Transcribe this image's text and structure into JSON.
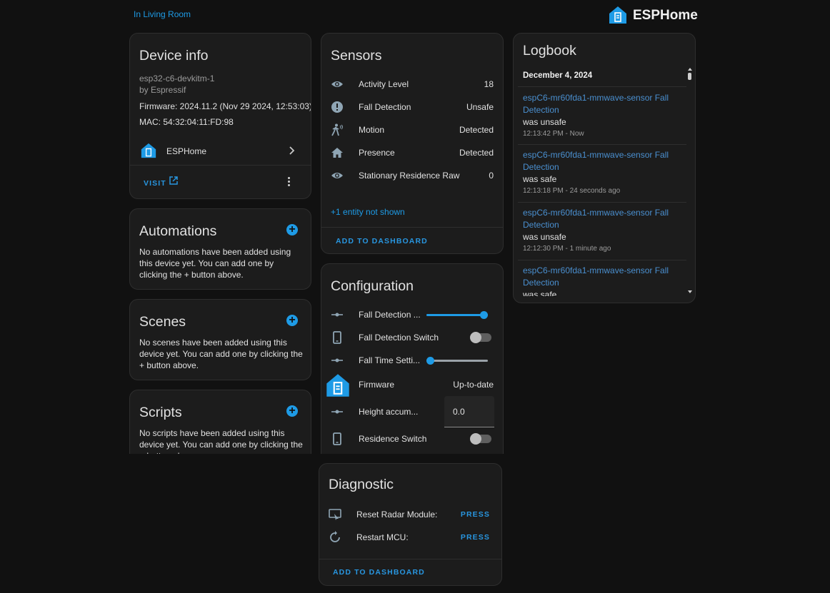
{
  "header": {
    "area_link": "In Living Room",
    "brand": "ESPHome",
    "brand_color": "#1e9be6"
  },
  "device_info": {
    "title": "Device info",
    "model": "esp32-c6-devkitm-1",
    "manufacturer": "by Espressif",
    "firmware": "Firmware: 2024.11.2 (Nov 29 2024, 12:53:03)",
    "mac": "MAC: 54:32:04:11:FD:98",
    "integration": "ESPHome",
    "visit_label": "VISIT"
  },
  "automations": {
    "title": "Automations",
    "text": "No automations have been added using this device yet. You can add one by clicking the + button above."
  },
  "scenes": {
    "title": "Scenes",
    "text": "No scenes have been added using this device yet. You can add one by clicking the + button above."
  },
  "scripts": {
    "title": "Scripts",
    "text": "No scripts have been added using this device yet. You can add one by clicking the + button above."
  },
  "sensors": {
    "title": "Sensors",
    "rows": [
      {
        "icon": "eye-icon",
        "label": "Activity Level",
        "value": "18"
      },
      {
        "icon": "alert-circle-icon",
        "label": "Fall Detection",
        "value": "Unsafe"
      },
      {
        "icon": "motion-icon",
        "label": "Motion",
        "value": "Detected"
      },
      {
        "icon": "home-icon",
        "label": "Presence",
        "value": "Detected"
      },
      {
        "icon": "eye-icon",
        "label": "Stationary Residence Raw",
        "value": "0"
      }
    ],
    "more_link": "+1 entity not shown",
    "add_label": "ADD TO DASHBOARD"
  },
  "configuration": {
    "title": "Configuration",
    "fall_detection_label": "Fall Detection ...",
    "fall_detection_level": 1.0,
    "fall_switch_label": "Fall Detection Switch",
    "fall_switch_on": false,
    "fall_time_label": "Fall Time Setti...",
    "fall_time_level": 0.0,
    "firmware_label": "Firmware",
    "firmware_value": "Up-to-date",
    "height_label": "Height accum...",
    "height_value": "0.0",
    "residence_label": "Residence Switch",
    "residence_on": false
  },
  "diagnostic": {
    "title": "Diagnostic",
    "reset_label": "Reset Radar Module:",
    "reset_action": "PRESS",
    "restart_label": "Restart MCU:",
    "restart_action": "PRESS",
    "add_label": "ADD TO DASHBOARD"
  },
  "logbook": {
    "title": "Logbook",
    "date": "December 4, 2024",
    "entries": [
      {
        "entity": "espC6-mr60fda1-mmwave-sensor Fall Detection",
        "state": "was unsafe",
        "time": "12:13:42 PM - Now"
      },
      {
        "entity": "espC6-mr60fda1-mmwave-sensor Fall Detection",
        "state": "was safe",
        "time": "12:13:18 PM - 24 seconds ago"
      },
      {
        "entity": "espC6-mr60fda1-mmwave-sensor Fall Detection",
        "state": "was unsafe",
        "time": "12:12:30 PM - 1 minute ago"
      },
      {
        "entity": "espC6-mr60fda1-mmwave-sensor Fall Detection",
        "state": "was safe",
        "time": ""
      }
    ]
  }
}
